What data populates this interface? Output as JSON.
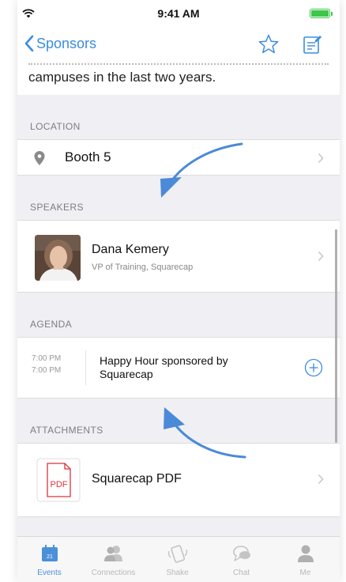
{
  "status_bar": {
    "time": "9:41 AM"
  },
  "nav": {
    "back_label": "Sponsors"
  },
  "description": {
    "text": "campuses in the last two years."
  },
  "location": {
    "header": "LOCATION",
    "value": "Booth 5"
  },
  "speakers": {
    "header": "SPEAKERS",
    "name": "Dana Kemery",
    "title": "VP of Training, Squarecap"
  },
  "agenda": {
    "header": "AGENDA",
    "start_time": "7:00 PM",
    "end_time": "7:00 PM",
    "title": "Happy Hour sponsored by Squarecap"
  },
  "attachments": {
    "header": "ATTACHMENTS",
    "pdf_badge": "PDF",
    "name": "Squarecap PDF"
  },
  "tabbar": {
    "events_icon_num": "21",
    "tabs": [
      {
        "label": "Events",
        "icon": "calendar-icon",
        "active": true
      },
      {
        "label": "Connections",
        "icon": "people-icon",
        "active": false
      },
      {
        "label": "Shake",
        "icon": "shake-icon",
        "active": false
      },
      {
        "label": "Chat",
        "icon": "chat-icon",
        "active": false
      },
      {
        "label": "Me",
        "icon": "person-icon",
        "active": false
      }
    ]
  },
  "colors": {
    "accent": "#3a8de0",
    "annotation_arrow": "#4a8ad8",
    "pdf_red": "#d9343a",
    "battery": "#3ec54a"
  }
}
